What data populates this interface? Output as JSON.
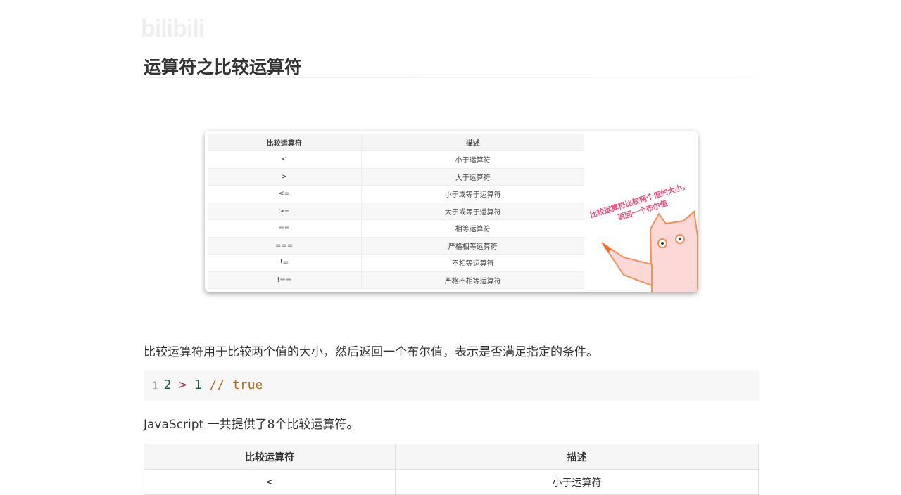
{
  "watermark": "bilibili",
  "title": "运算符之比较运算符",
  "image_table": {
    "headers": [
      "比较运算符",
      "描述"
    ],
    "rows": [
      [
        "<",
        "小于运算符"
      ],
      [
        ">",
        "大于运算符"
      ],
      [
        "<=",
        "小于或等于运算符"
      ],
      [
        ">=",
        "大于或等于运算符"
      ],
      [
        "==",
        "相等运算符"
      ],
      [
        "===",
        "严格相等运算符"
      ],
      [
        "!=",
        "不相等运算符"
      ],
      [
        "!==",
        "严格不相等运算符"
      ]
    ],
    "caption": "比较运算符比较两个值的大小，返回一个布尔值"
  },
  "paragraph1": "比较运算符用于比较两个值的大小，然后返回一个布尔值，表示是否满足指定的条件。",
  "code": {
    "line": "1",
    "a": "2",
    "op": ">",
    "b": "1",
    "comment": "// true"
  },
  "paragraph2": "JavaScript 一共提供了8个比较运算符。",
  "table": {
    "headers": [
      "比较运算符",
      "描述"
    ],
    "rows": [
      [
        "<",
        "小于运算符"
      ]
    ]
  }
}
